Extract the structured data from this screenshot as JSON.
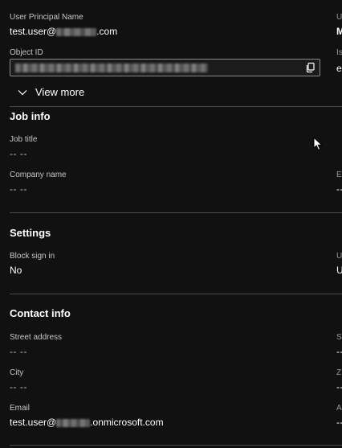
{
  "identity": {
    "upn_label": "User Principal Name",
    "upn_prefix": "test.user@",
    "upn_suffix": ".com",
    "object_id_label": "Object ID",
    "view_more": "View more",
    "right_col": {
      "upn_label_stub": "U",
      "upn_value_stub": "M",
      "object_id_label_stub": "Is",
      "object_id_value_stub": "e"
    }
  },
  "job_info": {
    "title": "Job info",
    "job_title_label": "Job title",
    "job_title_value": "-- --",
    "company_label": "Company name",
    "company_value": "-- --",
    "right_col": {
      "company_label_stub": "E",
      "company_value_stub": "--"
    }
  },
  "settings": {
    "title": "Settings",
    "block_signin_label": "Block sign in",
    "block_signin_value": "No",
    "right_col": {
      "label_stub": "U",
      "value_stub": "U"
    }
  },
  "contact_info": {
    "title": "Contact info",
    "street_label": "Street address",
    "street_value": "-- --",
    "city_label": "City",
    "city_value": "-- --",
    "email_label": "Email",
    "email_prefix": "test.user@",
    "email_suffix": ".onmicrosoft.com",
    "right_col": {
      "street_label_stub": "S",
      "street_value_stub": "--",
      "city_label_stub": "Z",
      "city_value_stub": "--",
      "email_label_stub": "A",
      "email_value_stub": "--"
    }
  },
  "icons": {
    "copy": "copy-icon",
    "chevron": "chevron-down-icon",
    "cursor": "mouse-cursor-icon"
  },
  "colors": {
    "background": "#111111",
    "text": "#ffffff",
    "label": "#c8c6c4",
    "divider": "#4a4a4a",
    "link": "#479ef5"
  }
}
